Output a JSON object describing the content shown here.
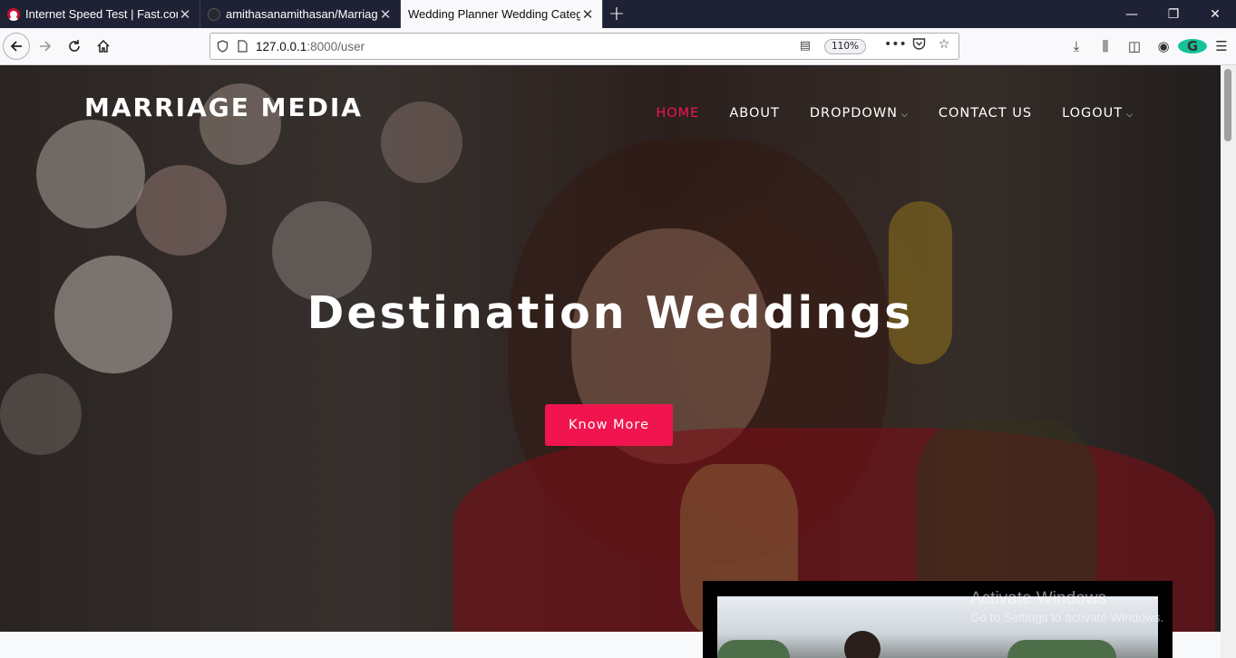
{
  "browser": {
    "tabs": [
      {
        "title": "Internet Speed Test | Fast.com",
        "favicon": "fast-icon",
        "active": false
      },
      {
        "title": "amithasanamithasan/MarriageMedia",
        "favicon": "github-icon",
        "active": false
      },
      {
        "title": "Wedding Planner Wedding Category",
        "favicon": "",
        "active": true
      }
    ],
    "url_host": "127.0.0.1",
    "url_rest": ":8000/user",
    "zoom": "110%"
  },
  "site": {
    "brand": "MARRIAGE MEDIA",
    "menu": {
      "home": "HOME",
      "about": "ABOUT",
      "dropdown": "DROPDOWN",
      "contact": "CONTACT US",
      "logout": "LOGOUT"
    },
    "headline": "Destination Weddings",
    "cta": "Know More",
    "accent": "#f0154f"
  },
  "os": {
    "watermark_title": "Activate Windows",
    "watermark_sub": "Go to Settings to activate Windows."
  }
}
